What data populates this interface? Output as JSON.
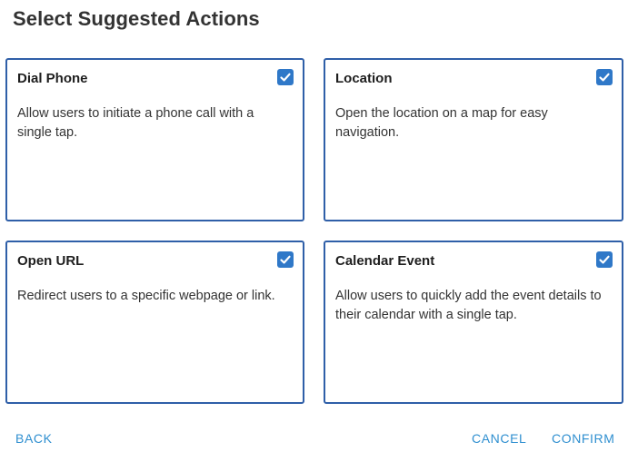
{
  "dialog": {
    "title": "Select Suggested Actions"
  },
  "cards": [
    {
      "title": "Dial Phone",
      "description": "Allow users to initiate a phone call with a single tap.",
      "checked": true
    },
    {
      "title": "Location",
      "description": "Open the location on a map for easy navigation.",
      "checked": true
    },
    {
      "title": "Open URL",
      "description": "Redirect users to a specific webpage or link.",
      "checked": true
    },
    {
      "title": "Calendar Event",
      "description": "Allow users to quickly add the event details to their calendar with a single tap.",
      "checked": true
    }
  ],
  "footer": {
    "back_label": "BACK",
    "cancel_label": "CANCEL",
    "confirm_label": "CONFIRM"
  },
  "colors": {
    "card_border": "#2f5fa8",
    "checkbox_fill": "#2f78c8",
    "button_text": "#2f8fd0"
  },
  "icons": {
    "checkbox": "checkmark-icon"
  }
}
